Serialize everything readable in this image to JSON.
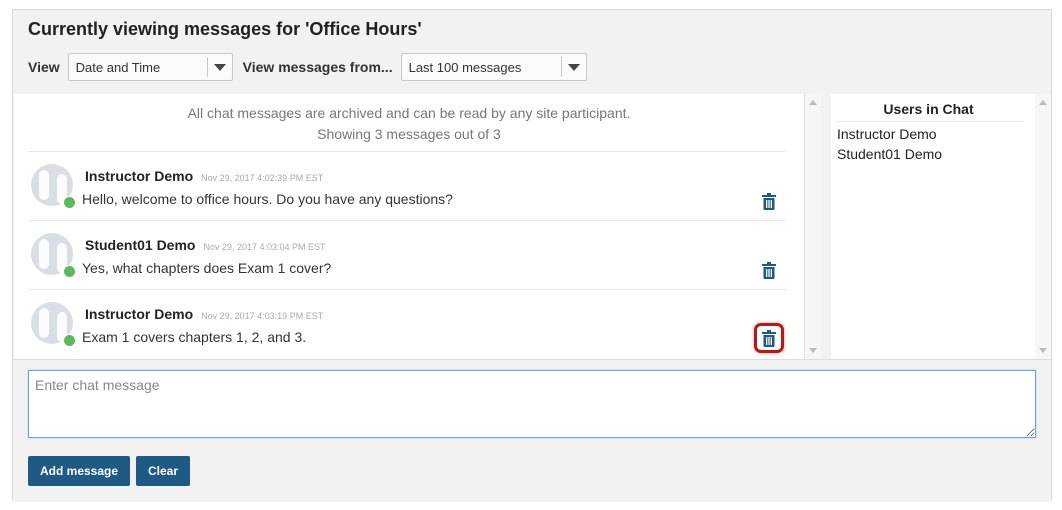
{
  "header": {
    "title": "Currently viewing messages for 'Office Hours'",
    "view_label": "View",
    "view_value": "Date and Time",
    "from_label": "View messages from...",
    "from_value": "Last 100 messages"
  },
  "info": {
    "line1": "All chat messages are archived and can be read by any site participant.",
    "line2": "Showing 3 messages out of 3"
  },
  "messages": [
    {
      "user": "Instructor Demo",
      "time": "Nov 29, 2017 4:02:39 PM EST",
      "text": "Hello, welcome to office hours. Do you have any questions?"
    },
    {
      "user": "Student01 Demo",
      "time": "Nov 29, 2017 4:03:04 PM EST",
      "text": "Yes, what chapters does Exam 1 cover?"
    },
    {
      "user": "Instructor Demo",
      "time": "Nov 29, 2017 4:03:19 PM EST",
      "text": "Exam 1 covers chapters 1, 2, and 3."
    }
  ],
  "users_panel": {
    "title": "Users in Chat",
    "users": [
      "Instructor Demo",
      "Student01 Demo"
    ]
  },
  "composer": {
    "placeholder": "Enter chat message",
    "add_label": "Add message",
    "clear_label": "Clear"
  },
  "colors": {
    "button": "#1e5a83",
    "trash_icon": "#1e5a83",
    "presence": "#5cb85c",
    "highlight": "#b01c1c"
  }
}
